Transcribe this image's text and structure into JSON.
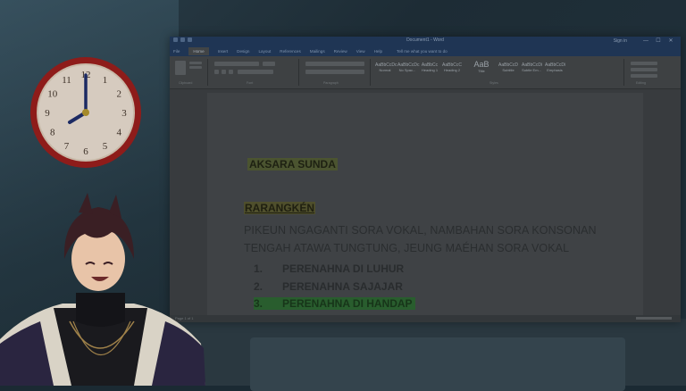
{
  "window": {
    "title": "Document1 - Word",
    "user": "Sign in",
    "minimize": "—",
    "maximize": "☐",
    "close": "✕"
  },
  "ribbon": {
    "tabs": [
      "File",
      "Home",
      "Insert",
      "Design",
      "Layout",
      "References",
      "Mailings",
      "Review",
      "View",
      "Help"
    ],
    "tell_me": "Tell me what you want to do",
    "styles": [
      {
        "preview": "AaBbCcDc",
        "name": "Normal"
      },
      {
        "preview": "AaBbCcDc",
        "name": "No Spac..."
      },
      {
        "preview": "AaBbCc",
        "name": "Heading 1"
      },
      {
        "preview": "AaBbCcC",
        "name": "Heading 2"
      },
      {
        "preview": "AaB",
        "name": "Title"
      },
      {
        "preview": "AaBbCcD",
        "name": "Subtitle"
      },
      {
        "preview": "AaBbCcDi",
        "name": "Subtle Em..."
      },
      {
        "preview": "AaBbCcDi",
        "name": "Emphasis"
      }
    ],
    "group_labels": [
      "Clipboard",
      "Font",
      "Paragraph",
      "Styles",
      "Editing"
    ]
  },
  "document": {
    "heading1": "AKSARA SUNDA",
    "heading2": "RARANGKÉN",
    "paragraph": "PIKEUN NGAGANTI SORA VOKAL, NAMBAHAN SORA KONSONAN TENGAH ATAWA TUNGTUNG, JEUNG MAÉHAN SORA VOKAL",
    "list": [
      {
        "num": "1.",
        "text": "PERENAHNA DI LUHUR"
      },
      {
        "num": "2.",
        "text": "PERENAHNA SAJAJAR"
      },
      {
        "num": "3.",
        "text": "PERENAHNA DI HANDAP"
      }
    ]
  },
  "status": {
    "left": "Page 1 of 1"
  },
  "clock": {
    "numbers": [
      "12",
      "1",
      "2",
      "3",
      "4",
      "5",
      "6",
      "7",
      "8",
      "9",
      "10",
      "11"
    ],
    "time": "8:00"
  },
  "colors": {
    "highlight_yellow": "#4b5430",
    "highlight_green": "#295d2e",
    "clock_rim": "#8e1c1a",
    "titlebar": "#1f3554"
  }
}
